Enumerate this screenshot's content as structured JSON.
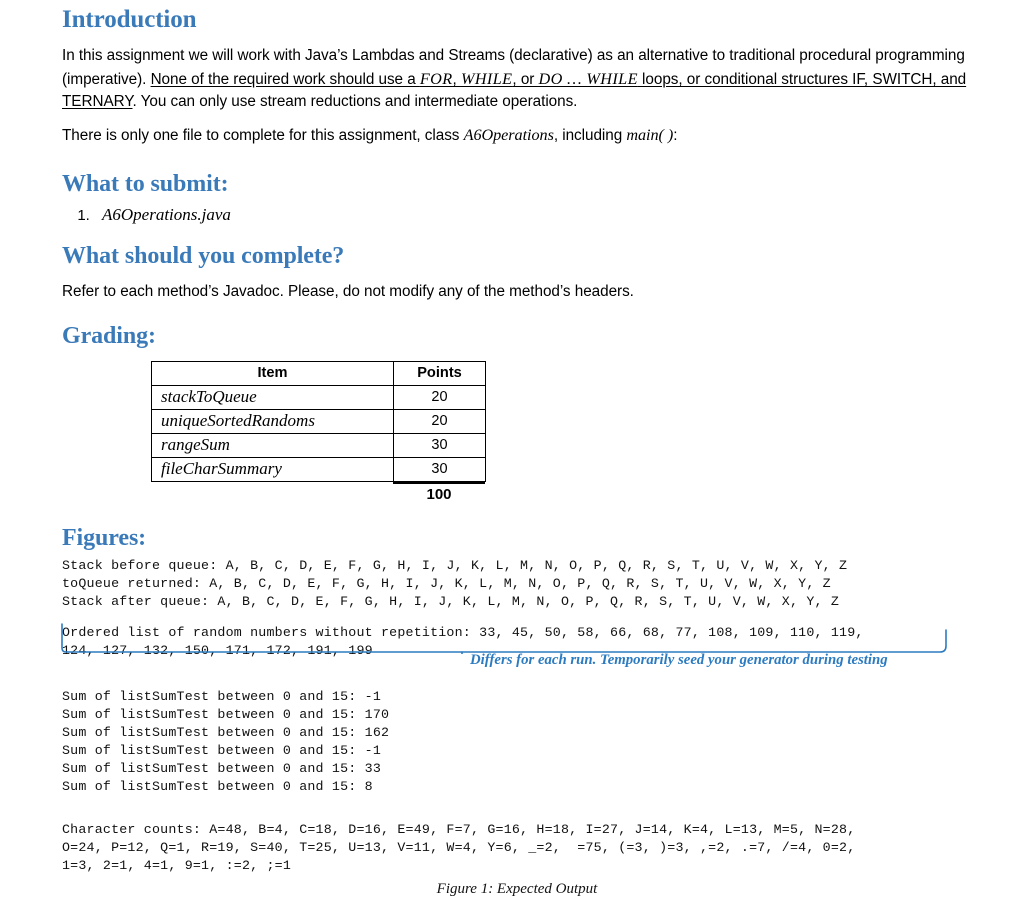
{
  "sections": {
    "intro": {
      "heading": "Introduction",
      "para1_a": "In this assignment we will work with Java’s Lambdas and Streams (declarative) as an alternative to traditional procedural programming (imperative). ",
      "para1_underline_lead": "None of the required work should use a ",
      "para1_kw1": "FOR",
      "para1_sep1": ", ",
      "para1_kw2": "WHILE",
      "para1_sep2": ", or ",
      "para1_kw3": "DO … WHILE",
      "para1_underline_tail": " loops, or conditional structures IF, SWITCH, and TERNARY",
      "para1_b": ". You can only use stream reductions and intermediate operations.",
      "para2_a": "There is only one file to complete for this assignment, class ",
      "para2_class": "A6Operations",
      "para2_b": ", including ",
      "para2_main": "main( )",
      "para2_c": ":"
    },
    "submit": {
      "heading": "What to submit:",
      "items": [
        "A6Operations.java"
      ]
    },
    "complete": {
      "heading": "What should you complete?",
      "para": "Refer to each method’s Javadoc. Please, do not modify any of the method’s headers."
    },
    "grading": {
      "heading": "Grading:",
      "columns": [
        "Item",
        "Points"
      ],
      "rows": [
        {
          "item": "stackToQueue",
          "points": "20"
        },
        {
          "item": "uniqueSortedRandoms",
          "points": "20"
        },
        {
          "item": "rangeSum",
          "points": "30"
        },
        {
          "item": "fileCharSummary",
          "points": "30"
        }
      ],
      "total": "100"
    },
    "figures": {
      "heading": "Figures:",
      "stack_block": "Stack before queue: A, B, C, D, E, F, G, H, I, J, K, L, M, N, O, P, Q, R, S, T, U, V, W, X, Y, Z\ntoQueue returned: A, B, C, D, E, F, G, H, I, J, K, L, M, N, O, P, Q, R, S, T, U, V, W, X, Y, Z\nStack after queue: A, B, C, D, E, F, G, H, I, J, K, L, M, N, O, P, Q, R, S, T, U, V, W, X, Y, Z",
      "random_block": "Ordered list of random numbers without repetition: 33, 45, 50, 58, 66, 68, 77, 108, 109, 110, 119,\n124, 127, 132, 150, 171, 172, 191, 199",
      "annotation": "Differs for each run. Temporarily seed your generator during testing",
      "annotation_color": "#2c7bc1",
      "sum_block": "Sum of listSumTest between 0 and 15: -1\nSum of listSumTest between 0 and 15: 170\nSum of listSumTest between 0 and 15: 162\nSum of listSumTest between 0 and 15: -1\nSum of listSumTest between 0 and 15: 33\nSum of listSumTest between 0 and 15: 8",
      "charcount_block": "Character counts: A=48, B=4, C=18, D=16, E=49, F=7, G=16, H=18, I=27, J=14, K=4, L=13, M=5, N=28,\nO=24, P=12, Q=1, R=19, S=40, T=25, U=13, V=11, W=4, Y=6, _=2,  =75, (=3, )=3, ,=2, .=7, /=4, 0=2,\n1=3, 2=1, 4=1, 9=1, :=2, ;=1",
      "caption": "Figure 1: Expected Output"
    }
  },
  "theme": {
    "heading_blue": "#3a7ab9",
    "annotation_blue": "#2c7bc1",
    "text_black": "#000000"
  }
}
